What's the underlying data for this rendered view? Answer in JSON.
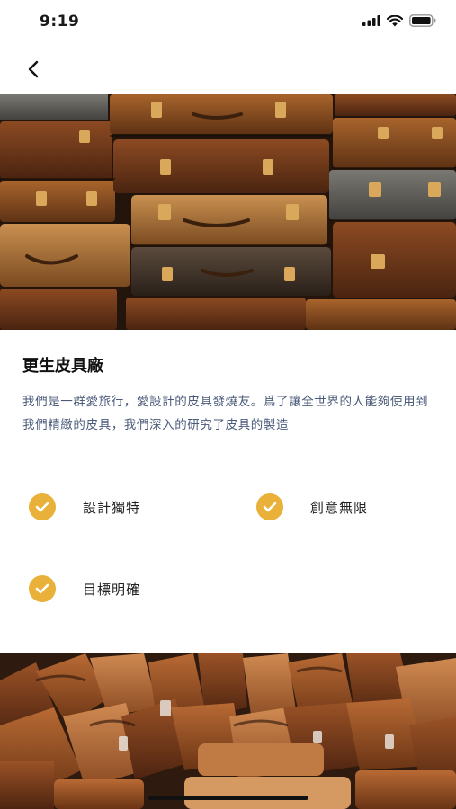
{
  "status_bar": {
    "time": "9:19"
  },
  "hero": {
    "image": "stacked-vintage-suitcases"
  },
  "section": {
    "title": "更生皮具廠",
    "description": "我們是一群愛旅行，愛設計的皮具發燒友。爲了讓全世界的人能夠使用到我們精緻的皮具，我們深入的研究了皮具的製造"
  },
  "features": [
    {
      "label": "設計獨特"
    },
    {
      "label": "創意無限"
    },
    {
      "label": "目標明確"
    }
  ],
  "bottom_image": {
    "image": "leather-bags-pile"
  },
  "colors": {
    "accent": "#e9b13a",
    "description_text": "#4a5a7a"
  }
}
